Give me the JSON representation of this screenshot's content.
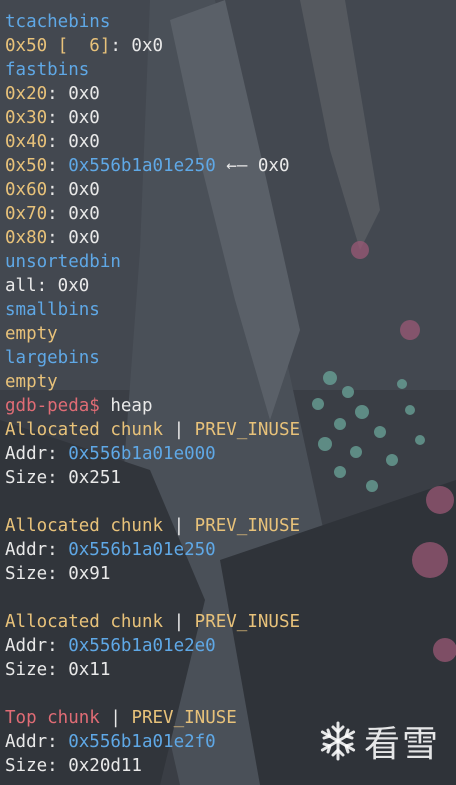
{
  "colors": {
    "heading": "#5fa8e6",
    "size": "#e8c27a",
    "text": "#e9e9e9",
    "prompt": "#e06c75",
    "address": "#5fa8e6"
  },
  "lines": [
    {
      "heading": "tcachebins"
    },
    {
      "size": "0x50 [  6]",
      "text": ": 0x0"
    },
    {
      "heading": "fastbins"
    },
    {
      "size": "0x20",
      "text": ": 0x0"
    },
    {
      "size": "0x30",
      "text": ": 0x0"
    },
    {
      "size": "0x40",
      "text": ": 0x0"
    },
    {
      "size": "0x50",
      "sep": ": ",
      "addr": "0x556b1a01e250",
      "tail": " ←— 0x0"
    },
    {
      "size": "0x60",
      "text": ": 0x0"
    },
    {
      "size": "0x70",
      "text": ": 0x0"
    },
    {
      "size": "0x80",
      "text": ": 0x0"
    },
    {
      "heading": "unsortedbin"
    },
    {
      "text": "all: 0x0"
    },
    {
      "heading": "smallbins"
    },
    {
      "size": "empty"
    },
    {
      "heading": "largebins"
    },
    {
      "size": "empty"
    },
    {
      "prompt": "gdb-peda$",
      "text": " heap"
    },
    {
      "chunk": "Allocated chunk",
      "pipe": " | ",
      "flag": "PREV_INUSE"
    },
    {
      "label": "Addr: ",
      "addr": "0x556b1a01e000"
    },
    {
      "text": "Size: 0x251"
    },
    {},
    {
      "chunk": "Allocated chunk",
      "pipe": " | ",
      "flag": "PREV_INUSE"
    },
    {
      "label": "Addr: ",
      "addr": "0x556b1a01e250"
    },
    {
      "text": "Size: 0x91"
    },
    {},
    {
      "chunk": "Allocated chunk",
      "pipe": " | ",
      "flag": "PREV_INUSE"
    },
    {
      "label": "Addr: ",
      "addr": "0x556b1a01e2e0"
    },
    {
      "text": "Size: 0x11"
    },
    {},
    {
      "top": "Top chunk",
      "pipe": " | ",
      "flag": "PREV_INUSE"
    },
    {
      "label": "Addr: ",
      "addr": "0x556b1a01e2f0"
    },
    {
      "text": "Size: 0x20d11"
    }
  ],
  "watermark": {
    "text": "看雪",
    "icon": "snowflake-icon"
  }
}
